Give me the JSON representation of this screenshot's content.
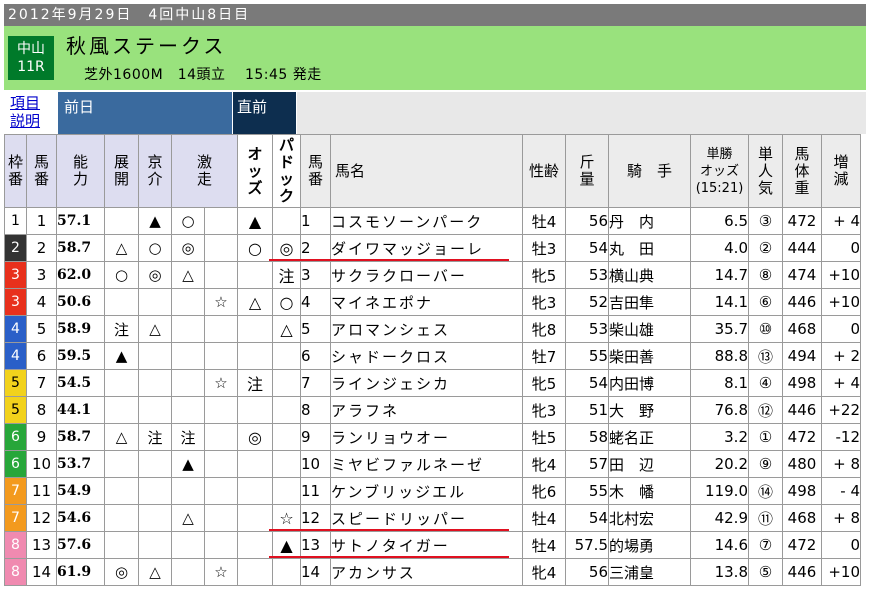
{
  "date_line": "2012年9月29日　4回中山8日目",
  "venue": "中山",
  "race_no": "11R",
  "race_name": "秋風ステークス",
  "race_info": "芝外1600M　14頭立　 15:45 発走",
  "help_link": {
    "line1": "項目",
    "line2": "説明"
  },
  "prev_day_label": "前日",
  "just_before_label": "直前",
  "columns": {
    "waku": [
      "枠",
      "番"
    ],
    "umaban": [
      "馬",
      "番"
    ],
    "noryoku": [
      "能",
      "力"
    ],
    "tenkai": [
      "展",
      "開"
    ],
    "kyosuke": [
      "京",
      "介"
    ],
    "gekiso": [
      "激",
      "走"
    ],
    "odds": [
      "オ",
      "ッ",
      "ズ"
    ],
    "paddock": [
      "パ",
      "ド",
      "ッ",
      "ク"
    ],
    "umaban2": [
      "馬",
      "番"
    ],
    "horse": "馬名",
    "sexage": "性齢",
    "kinryo": [
      "斤",
      "量"
    ],
    "jockey": "騎　手",
    "win_odds": [
      "単勝",
      "オッズ",
      "(15:21)"
    ],
    "ninki": [
      "単",
      "人",
      "気"
    ],
    "weight": [
      "馬",
      "体",
      "重"
    ],
    "change": [
      "増",
      "減"
    ]
  },
  "waku_colors": {
    "1": "#ffffff",
    "2": "#333333",
    "3": "#e8301c",
    "4": "#2a5fc8",
    "5": "#f2d21c",
    "6": "#27a63a",
    "7": "#f39a1e",
    "8": "#f08ab0"
  },
  "rows": [
    {
      "waku": "1",
      "umaban": "1",
      "noryoku": "57.1",
      "tenkai": "",
      "kyosuke": "▲",
      "gekiso": "○",
      "g2": "",
      "odds": "▲",
      "paddock": "",
      "umaban2": "1",
      "horse": "コスモソーンパーク",
      "sexage": "牡4",
      "kinryo": "56",
      "jockey": "丹　内",
      "win": "6.5",
      "ninki": "③",
      "weight": "472",
      "change": "+ 4"
    },
    {
      "waku": "2",
      "umaban": "2",
      "noryoku": "58.7",
      "tenkai": "△",
      "kyosuke": "○",
      "gekiso": "◎",
      "g2": "",
      "odds": "○",
      "paddock": "◎",
      "umaban2": "2",
      "horse": "ダイワマッジョーレ",
      "sexage": "牡3",
      "kinryo": "54",
      "jockey": "丸　田",
      "win": "4.0",
      "ninki": "②",
      "weight": "444",
      "change": "0"
    },
    {
      "waku": "3",
      "umaban": "3",
      "noryoku": "62.0",
      "tenkai": "○",
      "kyosuke": "◎",
      "gekiso": "△",
      "g2": "",
      "odds": "",
      "paddock": "注",
      "umaban2": "3",
      "horse": "サクラクローバー",
      "sexage": "牝5",
      "kinryo": "53",
      "jockey": "横山典",
      "win": "14.7",
      "ninki": "⑧",
      "weight": "474",
      "change": "+10"
    },
    {
      "waku": "3",
      "umaban": "4",
      "noryoku": "50.6",
      "tenkai": "",
      "kyosuke": "",
      "gekiso": "",
      "g2": "☆",
      "odds": "△",
      "paddock": "○",
      "umaban2": "4",
      "horse": "マイネエポナ",
      "sexage": "牝3",
      "kinryo": "52",
      "jockey": "吉田隼",
      "win": "14.1",
      "ninki": "⑥",
      "weight": "446",
      "change": "+10"
    },
    {
      "waku": "4",
      "umaban": "5",
      "noryoku": "58.9",
      "tenkai": "注",
      "kyosuke": "△",
      "gekiso": "",
      "g2": "",
      "odds": "",
      "paddock": "△",
      "umaban2": "5",
      "horse": "アロマンシェス",
      "sexage": "牝8",
      "kinryo": "53",
      "jockey": "柴山雄",
      "win": "35.7",
      "ninki": "⑩",
      "weight": "468",
      "change": "0"
    },
    {
      "waku": "4",
      "umaban": "6",
      "noryoku": "59.5",
      "tenkai": "▲",
      "kyosuke": "",
      "gekiso": "",
      "g2": "",
      "odds": "",
      "paddock": "",
      "umaban2": "6",
      "horse": "シャドークロス",
      "sexage": "牡7",
      "kinryo": "55",
      "jockey": "柴田善",
      "win": "88.8",
      "ninki": "⑬",
      "weight": "494",
      "change": "+ 2"
    },
    {
      "waku": "5",
      "umaban": "7",
      "noryoku": "54.5",
      "tenkai": "",
      "kyosuke": "",
      "gekiso": "",
      "g2": "☆",
      "odds": "注",
      "paddock": "",
      "umaban2": "7",
      "horse": "ラインジェシカ",
      "sexage": "牝5",
      "kinryo": "54",
      "jockey": "内田博",
      "win": "8.1",
      "ninki": "④",
      "weight": "498",
      "change": "+ 4"
    },
    {
      "waku": "5",
      "umaban": "8",
      "noryoku": "44.1",
      "tenkai": "",
      "kyosuke": "",
      "gekiso": "",
      "g2": "",
      "odds": "",
      "paddock": "",
      "umaban2": "8",
      "horse": "アラフネ",
      "sexage": "牝3",
      "kinryo": "51",
      "jockey": "大　野",
      "win": "76.8",
      "ninki": "⑫",
      "weight": "446",
      "change": "+22"
    },
    {
      "waku": "6",
      "umaban": "9",
      "noryoku": "58.7",
      "tenkai": "△",
      "kyosuke": "注",
      "gekiso": "注",
      "g2": "",
      "odds": "◎",
      "paddock": "",
      "umaban2": "9",
      "horse": "ランリョウオー",
      "sexage": "牡5",
      "kinryo": "58",
      "jockey": "蛯名正",
      "win": "3.2",
      "ninki": "①",
      "weight": "472",
      "change": "-12"
    },
    {
      "waku": "6",
      "umaban": "10",
      "noryoku": "53.7",
      "tenkai": "",
      "kyosuke": "",
      "gekiso": "▲",
      "g2": "",
      "odds": "",
      "paddock": "",
      "umaban2": "10",
      "horse": "ミヤビファルネーゼ",
      "sexage": "牝4",
      "kinryo": "57",
      "jockey": "田　辺",
      "win": "20.2",
      "ninki": "⑨",
      "weight": "480",
      "change": "+ 8"
    },
    {
      "waku": "7",
      "umaban": "11",
      "noryoku": "54.9",
      "tenkai": "",
      "kyosuke": "",
      "gekiso": "",
      "g2": "",
      "odds": "",
      "paddock": "",
      "umaban2": "11",
      "horse": "ケンブリッジエル",
      "sexage": "牝6",
      "kinryo": "55",
      "jockey": "木　幡",
      "win": "119.0",
      "ninki": "⑭",
      "weight": "498",
      "change": "- 4"
    },
    {
      "waku": "7",
      "umaban": "12",
      "noryoku": "54.6",
      "tenkai": "",
      "kyosuke": "",
      "gekiso": "△",
      "g2": "",
      "odds": "",
      "paddock": "☆",
      "umaban2": "12",
      "horse": "スピードリッパー",
      "sexage": "牡4",
      "kinryo": "54",
      "jockey": "北村宏",
      "win": "42.9",
      "ninki": "⑪",
      "weight": "468",
      "change": "+ 8"
    },
    {
      "waku": "8",
      "umaban": "13",
      "noryoku": "57.6",
      "tenkai": "",
      "kyosuke": "",
      "gekiso": "",
      "g2": "",
      "odds": "",
      "paddock": "▲",
      "umaban2": "13",
      "horse": "サトノタイガー",
      "sexage": "牡4",
      "kinryo": "57.5",
      "jockey": "的場勇",
      "win": "14.6",
      "ninki": "⑦",
      "weight": "472",
      "change": "0"
    },
    {
      "waku": "8",
      "umaban": "14",
      "noryoku": "61.9",
      "tenkai": "◎",
      "kyosuke": "△",
      "gekiso": "",
      "g2": "☆",
      "odds": "",
      "paddock": "",
      "umaban2": "14",
      "horse": "アカンサス",
      "sexage": "牝4",
      "kinryo": "56",
      "jockey": "三浦皇",
      "win": "13.8",
      "ninki": "⑤",
      "weight": "446",
      "change": "+10"
    }
  ],
  "underlined_rows": [
    1,
    11,
    12
  ]
}
